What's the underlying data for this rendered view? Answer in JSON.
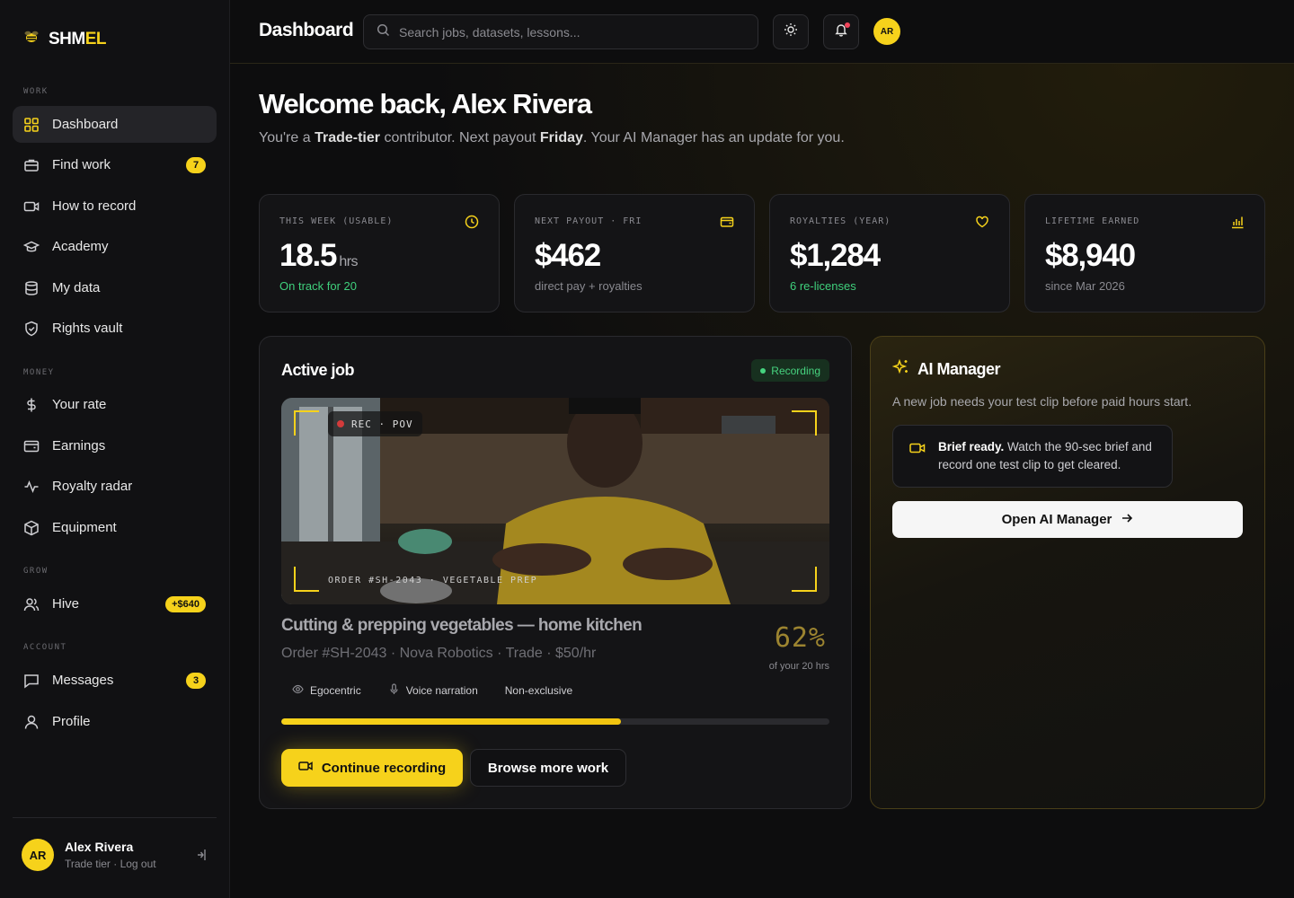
{
  "brand": {
    "name_part1": "SHM",
    "name_part2": "EL"
  },
  "nav": {
    "sections": {
      "work": "WORK",
      "money": "MONEY",
      "grow": "GROW",
      "account": "ACCOUNT"
    },
    "items": [
      {
        "label": "Dashboard",
        "icon": "grid-icon",
        "active": true
      },
      {
        "label": "Find work",
        "icon": "briefcase-icon",
        "badge": "7"
      },
      {
        "label": "How to record",
        "icon": "video-icon"
      },
      {
        "label": "Academy",
        "icon": "graduation-cap-icon"
      },
      {
        "label": "My data",
        "icon": "database-icon"
      },
      {
        "label": "Rights vault",
        "icon": "shield-icon"
      },
      {
        "label": "Your rate",
        "icon": "dollar-icon"
      },
      {
        "label": "Earnings",
        "icon": "wallet-icon"
      },
      {
        "label": "Royalty radar",
        "icon": "activity-icon"
      },
      {
        "label": "Equipment",
        "icon": "box-icon"
      },
      {
        "label": "Hive",
        "icon": "users-icon",
        "badge": "+$640"
      },
      {
        "label": "Messages",
        "icon": "message-icon",
        "badge": "3"
      },
      {
        "label": "Profile",
        "icon": "user-icon"
      }
    ]
  },
  "user": {
    "initials": "AR",
    "name": "Alex Rivera",
    "tier_logout": "Trade tier · Log out"
  },
  "topbar": {
    "title": "Dashboard",
    "search_placeholder": "Search jobs, datasets, lessons..."
  },
  "welcome": {
    "heading": "Welcome back, Alex Rivera",
    "sub_1": "You're a ",
    "sub_tier": "Trade-tier",
    "sub_2": " contributor. Next payout ",
    "sub_day": "Friday",
    "sub_3": ". Your AI Manager has an update for you."
  },
  "stats": [
    {
      "label": "THIS WEEK (USABLE)",
      "value": "18.5",
      "unit": "hrs",
      "sub": "On track for 20",
      "sub_green": true,
      "icon": "clock-icon"
    },
    {
      "label": "NEXT PAYOUT · FRI",
      "value": "$462",
      "unit": "",
      "sub": "direct pay + royalties",
      "sub_green": false,
      "icon": "wallet-icon"
    },
    {
      "label": "ROYALTIES (YEAR)",
      "value": "$1,284",
      "unit": "",
      "sub": "6 re-licenses",
      "sub_green": true,
      "icon": "heart-icon"
    },
    {
      "label": "LIFETIME EARNED",
      "value": "$8,940",
      "unit": "",
      "sub": "since Mar 2026",
      "sub_green": false,
      "icon": "bar-chart-icon"
    }
  ],
  "active_job": {
    "title": "Active job",
    "status": "Recording",
    "rec_tag": "REC · POV",
    "overlay": "ORDER #SH-2043 · VEGETABLE PREP",
    "name": "Cutting & prepping vegetables — home kitchen",
    "meta": "Order #SH-2043 · Nova Robotics · Trade · $50/hr",
    "percent": "62%",
    "percent_sub": "of your 20 hrs",
    "progress": 0.62,
    "tags": [
      "Egocentric",
      "Voice narration",
      "Non-exclusive"
    ],
    "primary_btn": "Continue recording",
    "secondary_btn": "Browse more work"
  },
  "ai_manager": {
    "title": "AI Manager",
    "description": "A new job needs your test clip before paid hours start.",
    "brief_bold": "Brief ready.",
    "brief_text": " Watch the 90-sec brief and record one test clip to get cleared.",
    "button": "Open AI Manager"
  },
  "colors": {
    "accent": "#f6d21b",
    "success": "#3fd07c",
    "danger": "#f0445a"
  }
}
